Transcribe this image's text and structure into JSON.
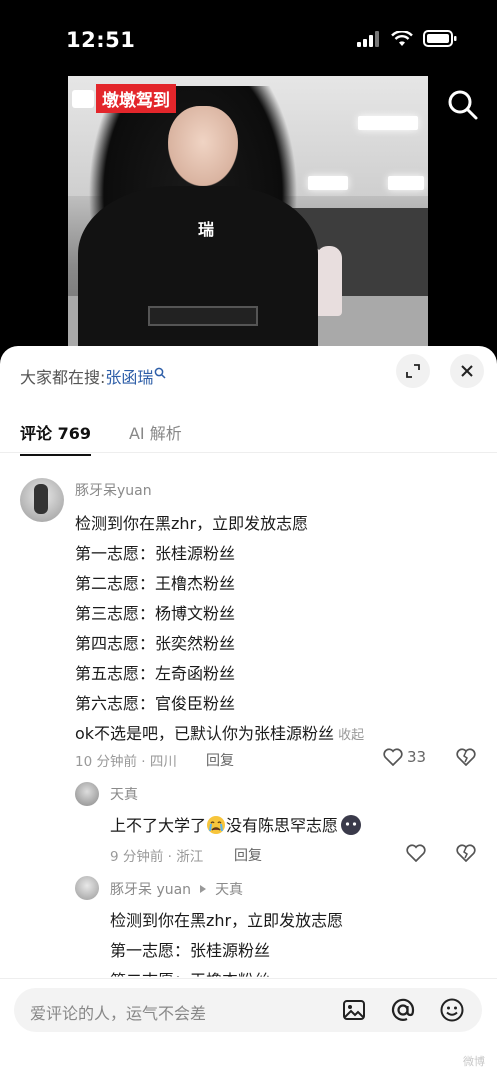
{
  "status": {
    "time": "12:51"
  },
  "video": {
    "badge": "墩墩驾到",
    "shirt_text": "瑞"
  },
  "sheet": {
    "search_prefix": "大家都在搜: ",
    "search_query": "张函瑞",
    "tabs": [
      {
        "label": "评论 769"
      },
      {
        "label": "AI 解析"
      }
    ]
  },
  "comments": [
    {
      "user": "豚牙呆yuan",
      "lines": [
        "检测到你在黑zhr，立即发放志愿",
        "第一志愿：张桂源粉丝",
        "第二志愿：王橹杰粉丝",
        "第三志愿：杨博文粉丝",
        "第四志愿：张奕然粉丝",
        "第五志愿：左奇函粉丝",
        "第六志愿：官俊臣粉丝",
        "ok不选是吧，已默认你为张桂源粉丝"
      ],
      "collapse": "收起",
      "meta": "10 分钟前 · 四川",
      "reply": "回复",
      "likes": "33"
    },
    {
      "user": "天真",
      "text_a": "上不了大学了",
      "text_b": "没有陈思罕志愿",
      "meta": "9 分钟前 · 浙江",
      "reply": "回复"
    },
    {
      "user": "豚牙呆 yuan",
      "reply_to": "天真",
      "lines": [
        "检测到你在黑zhr，立即发放志愿",
        "第一志愿：张桂源粉丝",
        "第二志愿：王橹杰粉丝"
      ]
    }
  ],
  "input": {
    "placeholder": "爱评论的人，运气不会差"
  },
  "watermark": "微博"
}
